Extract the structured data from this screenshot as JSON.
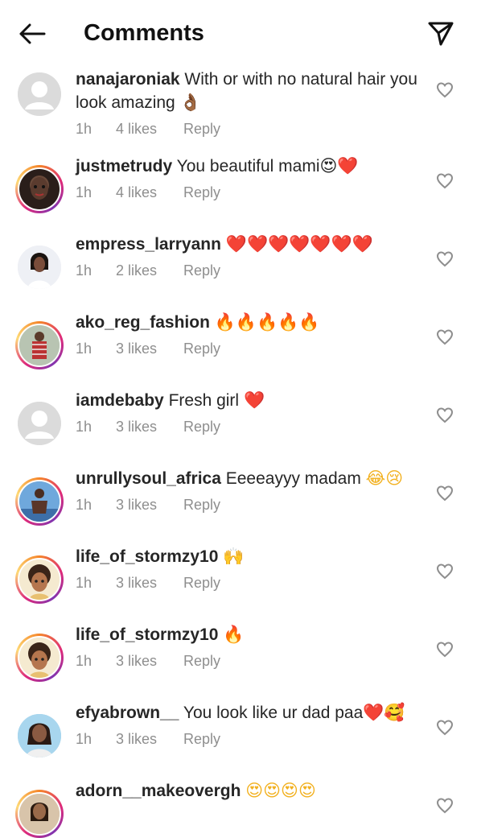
{
  "header": {
    "title": "Comments",
    "back_icon": "arrow-left-icon",
    "share_icon": "paper-plane-icon"
  },
  "comments": [
    {
      "username": "nanajaroniak",
      "text": "With or with no natural hair you look amazing",
      "emoji": "👌🏾",
      "time": "1h",
      "likes": "4 likes",
      "reply": "Reply",
      "avatar": "default"
    },
    {
      "username": "justmetrudy",
      "text": "You beautiful mami",
      "emoji": "😍❤️",
      "time": "1h",
      "likes": "4 likes",
      "reply": "Reply",
      "avatar": "photo"
    },
    {
      "username": "empress_larryann",
      "text": "",
      "emoji": "❤️❤️❤️❤️❤️❤️❤️",
      "time": "1h",
      "likes": "2 likes",
      "reply": "Reply",
      "avatar": "photo"
    },
    {
      "username": "ako_reg_fashion",
      "text": "",
      "emoji": "🔥🔥🔥🔥🔥",
      "time": "1h",
      "likes": "3 likes",
      "reply": "Reply",
      "avatar": "photo"
    },
    {
      "username": "iamdebaby",
      "text": "Fresh girl",
      "emoji": "❤️",
      "time": "1h",
      "likes": "3 likes",
      "reply": "Reply",
      "avatar": "default"
    },
    {
      "username": "unrullysoul_africa",
      "text": "Eeeeayyy madam",
      "emoji": "😂😢",
      "time": "1h",
      "likes": "3 likes",
      "reply": "Reply",
      "avatar": "photo"
    },
    {
      "username": "life_of_stormzy10",
      "text": "",
      "emoji": "🙌",
      "time": "1h",
      "likes": "3 likes",
      "reply": "Reply",
      "avatar": "cartoon"
    },
    {
      "username": "life_of_stormzy10",
      "text": "",
      "emoji": "🔥",
      "time": "1h",
      "likes": "3 likes",
      "reply": "Reply",
      "avatar": "cartoon"
    },
    {
      "username": "efyabrown__",
      "text": "You look like ur dad paa",
      "emoji": "❤️🥰",
      "time": "1h",
      "likes": "3 likes",
      "reply": "Reply",
      "avatar": "photo"
    },
    {
      "username": "adorn__makeovergh",
      "text": "",
      "emoji": "😍😍😍😍",
      "time": "",
      "likes": "",
      "reply": "",
      "avatar": "photo"
    }
  ],
  "colors": {
    "text": "#262626",
    "meta": "#8e8e8e",
    "ring_start": "#f58529",
    "ring_end": "#dd2a7b"
  }
}
